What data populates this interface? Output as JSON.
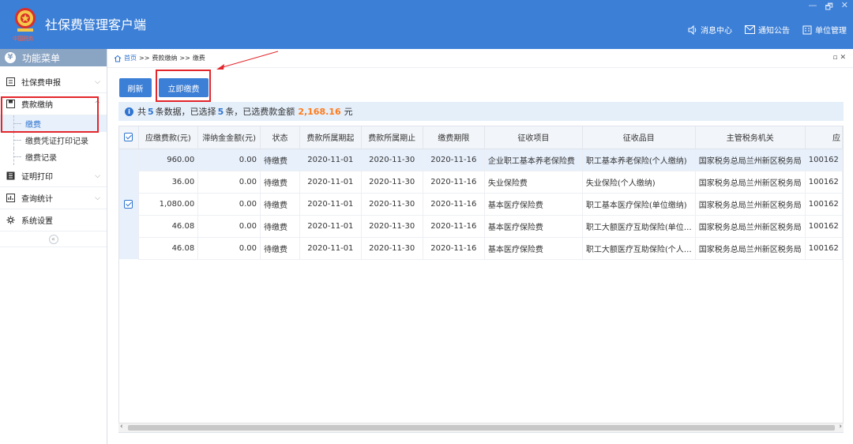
{
  "header": {
    "title": "社保费管理客户端",
    "logo_text": "中国税务",
    "window_controls": [
      "—",
      "🗗",
      "✕"
    ],
    "actions": [
      {
        "label": "消息中心",
        "icon": "speaker-icon"
      },
      {
        "label": "通知公告",
        "icon": "mail-icon"
      },
      {
        "label": "单位管理",
        "icon": "building-icon"
      }
    ]
  },
  "sidebar": {
    "title": "功能菜单",
    "items": [
      {
        "label": "社保费申报",
        "icon": "form-icon"
      },
      {
        "label": "费款缴纳",
        "icon": "pay-icon"
      },
      {
        "label": "证明打印",
        "icon": "print-icon"
      },
      {
        "label": "查询统计",
        "icon": "chart-icon"
      },
      {
        "label": "系统设置",
        "icon": "gear-icon"
      }
    ],
    "sub_items": [
      "缴费",
      "缴费凭证打印记录",
      "缴费记录"
    ],
    "collapse_glyph": "«"
  },
  "breadcrumb": {
    "home": "首页",
    "sep": ">>",
    "level1": "费款缴纳",
    "level2": "缴费"
  },
  "toolbar": {
    "refresh_label": "刷新",
    "pay_label": "立即缴费"
  },
  "info": {
    "prefix": "共",
    "total": "5",
    "mid1": "条数据，已选择",
    "selected": "5",
    "mid2": "条，已选费款金额",
    "amount": "2,168.16",
    "unit": "元"
  },
  "table": {
    "columns": [
      "应缴费款(元)",
      "滞纳金金额(元)",
      "状态",
      "费款所属期起",
      "费款所属期止",
      "缴费期限",
      "征收项目",
      "征收品目",
      "主管税务机关",
      "应"
    ],
    "rows": [
      [
        "960.00",
        "0.00",
        "待缴费",
        "2020-11-01",
        "2020-11-30",
        "2020-11-16",
        "企业职工基本养老保险费",
        "职工基本养老保险(个人缴纳)",
        "国家税务总局兰州新区税务局",
        "100162"
      ],
      [
        "36.00",
        "0.00",
        "待缴费",
        "2020-11-01",
        "2020-11-30",
        "2020-11-16",
        "失业保险费",
        "失业保险(个人缴纳)",
        "国家税务总局兰州新区税务局",
        "100162"
      ],
      [
        "1,080.00",
        "0.00",
        "待缴费",
        "2020-11-01",
        "2020-11-30",
        "2020-11-16",
        "基本医疗保险费",
        "职工基本医疗保险(单位缴纳)",
        "国家税务总局兰州新区税务局",
        "100162"
      ],
      [
        "46.08",
        "0.00",
        "待缴费",
        "2020-11-01",
        "2020-11-30",
        "2020-11-16",
        "基本医疗保险费",
        "职工大额医疗互助保险(单位…",
        "国家税务总局兰州新区税务局",
        "100162"
      ],
      [
        "46.08",
        "0.00",
        "待缴费",
        "2020-11-01",
        "2020-11-30",
        "2020-11-16",
        "基本医疗保险费",
        "职工大额医疗互助保险(个人…",
        "国家税务总局兰州新区税务局",
        "100162"
      ]
    ]
  },
  "colors": {
    "header_bg": "#3c7fd6",
    "accent": "#2f74d0",
    "amount": "#ff7a1a",
    "highlight_box": "#e2262b"
  }
}
